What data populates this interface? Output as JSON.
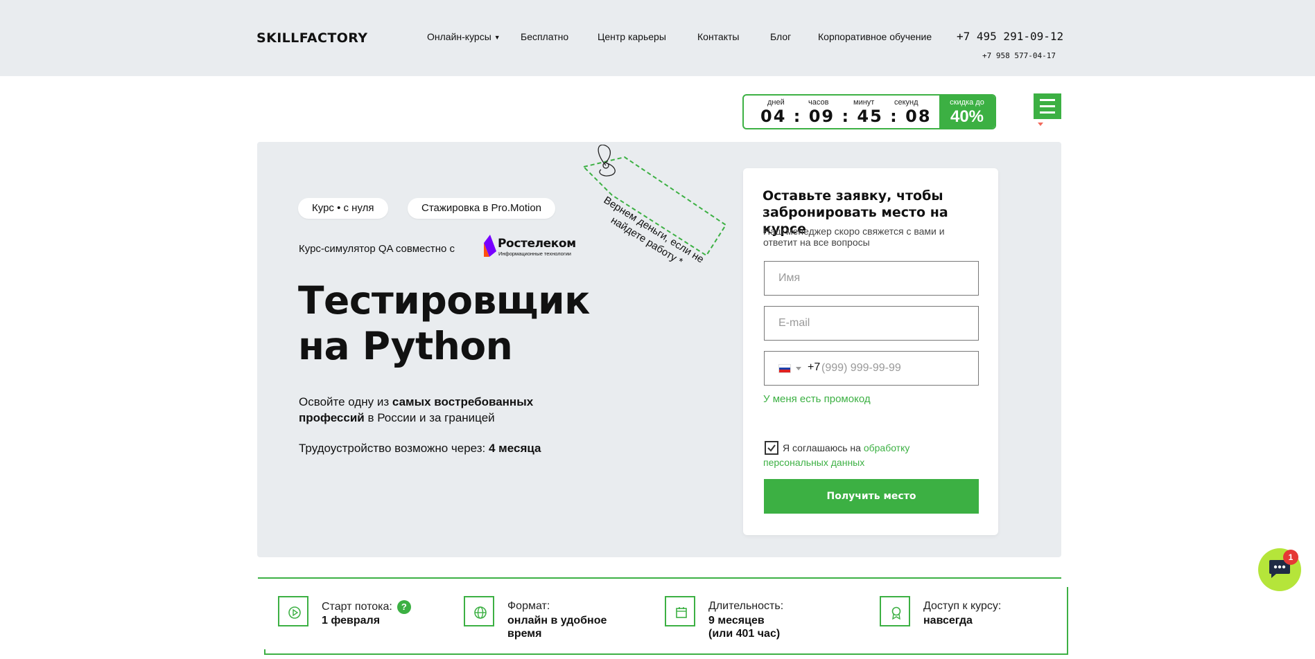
{
  "header": {
    "logo": "SKILLFACTORY",
    "nav": [
      "Онлайн-курсы",
      "Бесплатно",
      "Центр карьеры",
      "Контакты",
      "Блог",
      "Корпоративное обучение"
    ],
    "phone_main": "+7 495 291-09-12",
    "phone_secondary": "+7 958 577-04-17"
  },
  "timer": {
    "labels": [
      "дней",
      "часов",
      "минут",
      "секунд"
    ],
    "value": "04 : 09 : 45 : 08",
    "discount_label": "скидка до",
    "discount_value": "40%"
  },
  "hero": {
    "tags": [
      "Курс • с нуля",
      "Стажировка в Pro.Motion"
    ],
    "partner_text": "Курс-симулятор QA  совместно с",
    "partner_name": "Ростелеком",
    "partner_sub": "Информационные технологии",
    "title_line1": "Тестировщик",
    "title_line2": "на Python",
    "desc_prefix": "Освойте одну из ",
    "desc_bold": "самых востребованных профессий",
    "desc_suffix": " в России и за границей",
    "employ_prefix": "Трудоустройство возможно через: ",
    "employ_value": "4 месяца",
    "price_tag": "Вернем деньги, если не найдете работу *"
  },
  "form": {
    "title": "Оставьте заявку, чтобы забронировать место на курсе",
    "subtitle": "Наш менеджер скоро свяжется с вами и ответит на все вопросы",
    "name_placeholder": "Имя",
    "email_placeholder": "E-mail",
    "phone_code": "+7",
    "phone_placeholder": "(999) 999-99-99",
    "promo": "У меня есть промокод",
    "consent_prefix": "Я соглашаюсь на ",
    "consent_link": "обработку персональных данных",
    "submit": "Получить место"
  },
  "info": [
    {
      "label": "Старт потока:",
      "value": "1 февраля",
      "icon": "play-icon"
    },
    {
      "label": "Формат:",
      "value": "онлайн в удобное время",
      "icon": "globe-icon"
    },
    {
      "label": "Длительность:",
      "value": "9 месяцев (или 401 час)",
      "icon": "calendar-icon"
    },
    {
      "label": "Доступ к курсу:",
      "value": "навсегда",
      "icon": "award-icon"
    }
  ],
  "help_mark": "?",
  "chat": {
    "badge": "1"
  },
  "colors": {
    "accent": "#3cb043",
    "hero_bg": "#e9ecef",
    "header_bg": "#e9ecef",
    "chat": "#b5e53a"
  }
}
